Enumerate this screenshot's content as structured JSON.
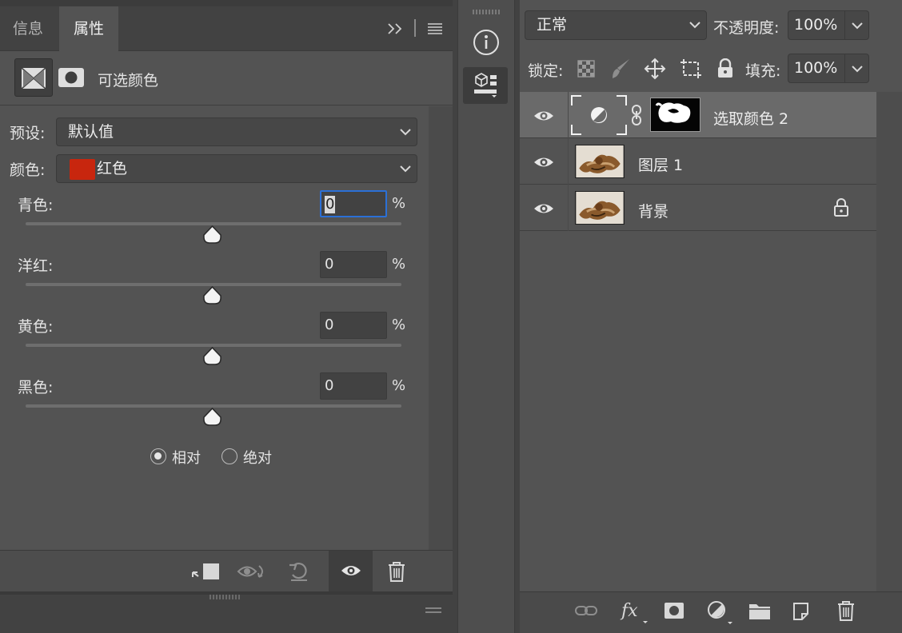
{
  "tabs": {
    "info": "信息",
    "properties": "属性"
  },
  "properties": {
    "adjustment_title": "可选颜色",
    "preset_label": "预设:",
    "preset_value": "默认值",
    "colors_label": "颜色:",
    "colors_value": "红色",
    "colors_swatch": "#c8260e",
    "sliders": [
      {
        "label": "青色:",
        "value": "0",
        "unit": "%"
      },
      {
        "label": "洋红:",
        "value": "0",
        "unit": "%"
      },
      {
        "label": "黄色:",
        "value": "0",
        "unit": "%"
      },
      {
        "label": "黑色:",
        "value": "0",
        "unit": "%"
      }
    ],
    "method": {
      "relative": "相对",
      "absolute": "绝对",
      "selected": "relative"
    }
  },
  "layers_panel": {
    "blend_mode": "正常",
    "opacity_label": "不透明度:",
    "opacity_value": "100%",
    "lock_label": "锁定:",
    "fill_label": "填充:",
    "fill_value": "100%",
    "layers": [
      {
        "name": "选取颜色 2",
        "type": "adjustment",
        "selected": true
      },
      {
        "name": "图层 1",
        "type": "image",
        "selected": false
      },
      {
        "name": "背景",
        "type": "image",
        "locked": true,
        "selected": false
      }
    ]
  },
  "colors": {
    "accent": "#2b70d6",
    "panel": "#535353",
    "selected_row": "#6a6a6a"
  }
}
